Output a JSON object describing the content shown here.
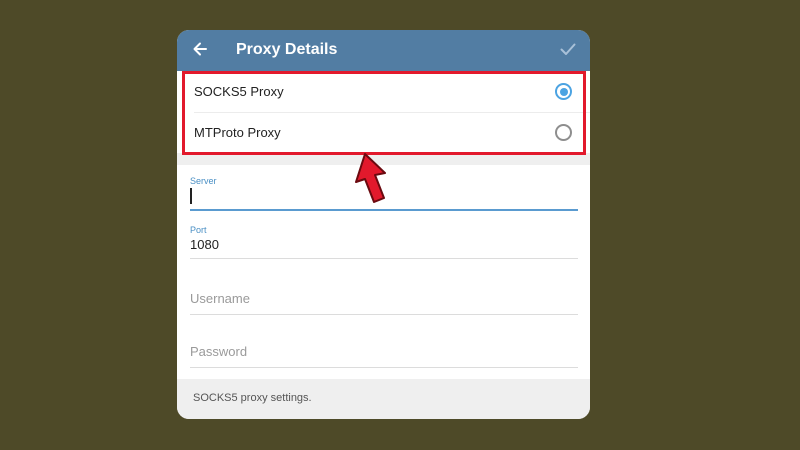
{
  "header": {
    "title": "Proxy Details",
    "bg_color": "#527da3"
  },
  "proxy_types": [
    {
      "label": "SOCKS5 Proxy",
      "selected": true
    },
    {
      "label": "MTProto Proxy",
      "selected": false
    }
  ],
  "fields": {
    "server": {
      "label": "Server",
      "value": ""
    },
    "port": {
      "label": "Port",
      "value": "1080"
    },
    "username": {
      "placeholder": "Username"
    },
    "password": {
      "placeholder": "Password"
    }
  },
  "footer": {
    "note": "SOCKS5 proxy settings."
  },
  "colors": {
    "accent": "#4ba3e2",
    "highlight": "#e2192c",
    "background": "#4e4a28"
  }
}
